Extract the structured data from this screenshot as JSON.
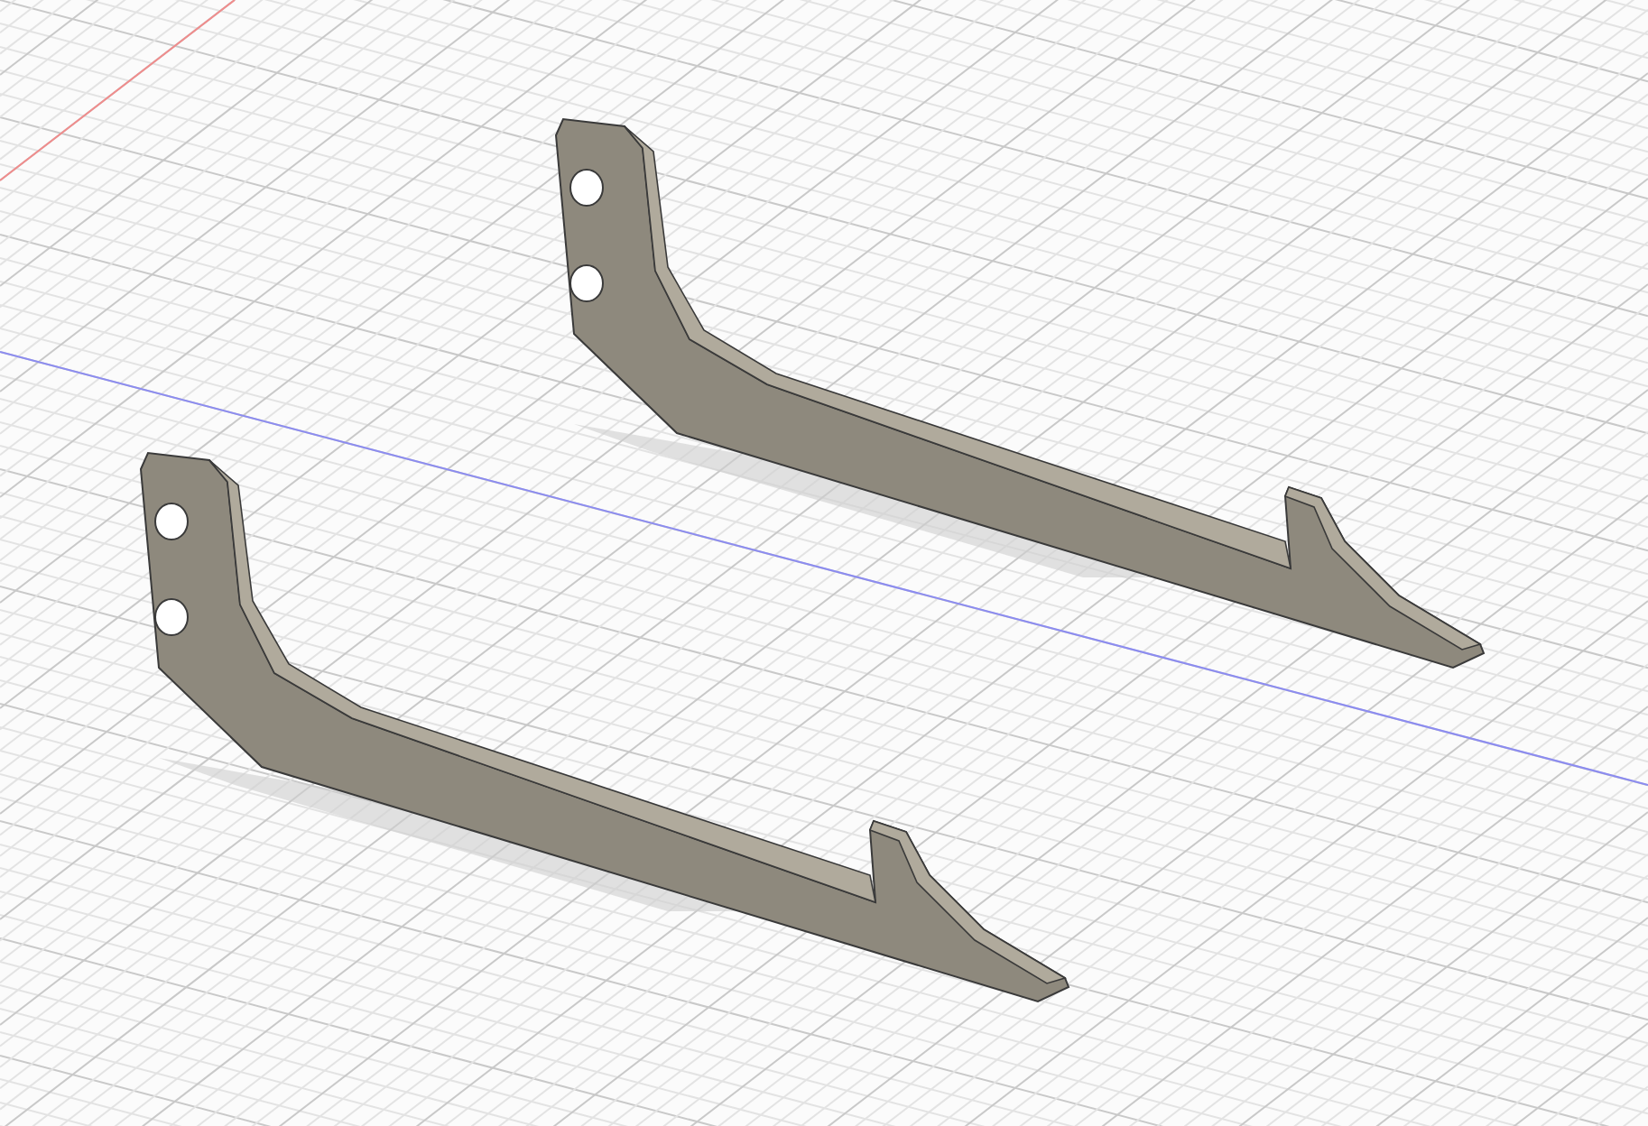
{
  "scene": {
    "parts": [
      {
        "kind": "bracket"
      },
      {
        "kind": "bracket"
      }
    ]
  }
}
